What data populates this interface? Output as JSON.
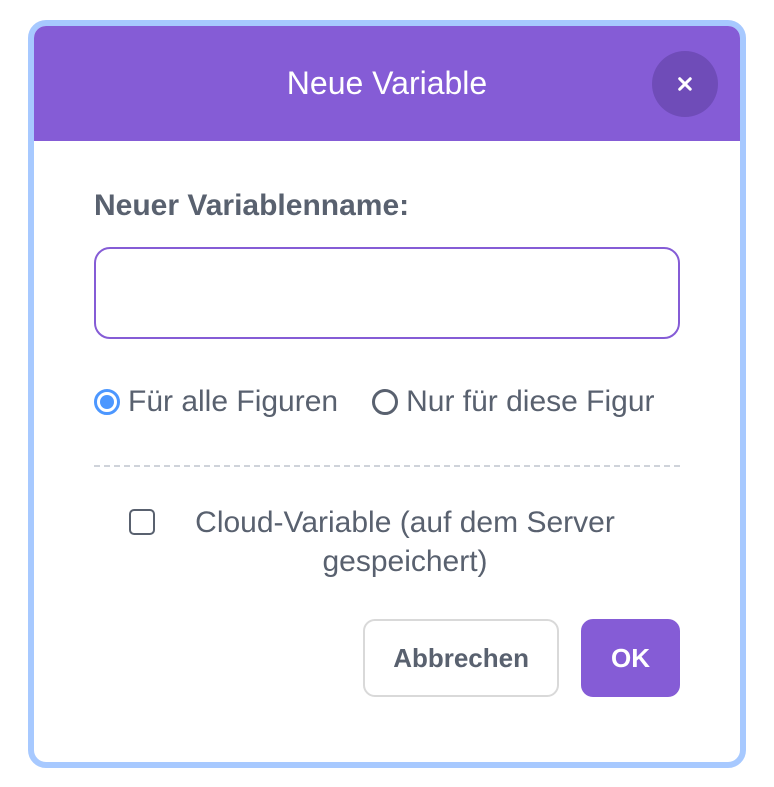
{
  "dialog": {
    "title": "Neue Variable",
    "field_label": "Neuer Variablenname:",
    "input_value": "",
    "radio": {
      "all_sprites": "Für alle Figuren",
      "this_sprite": "Nur für diese Figur",
      "selected": "all_sprites"
    },
    "cloud_checkbox": {
      "label": "Cloud-Variable (auf dem Server gespeichert)",
      "checked": false
    },
    "buttons": {
      "cancel": "Abbrechen",
      "ok": "OK"
    }
  }
}
